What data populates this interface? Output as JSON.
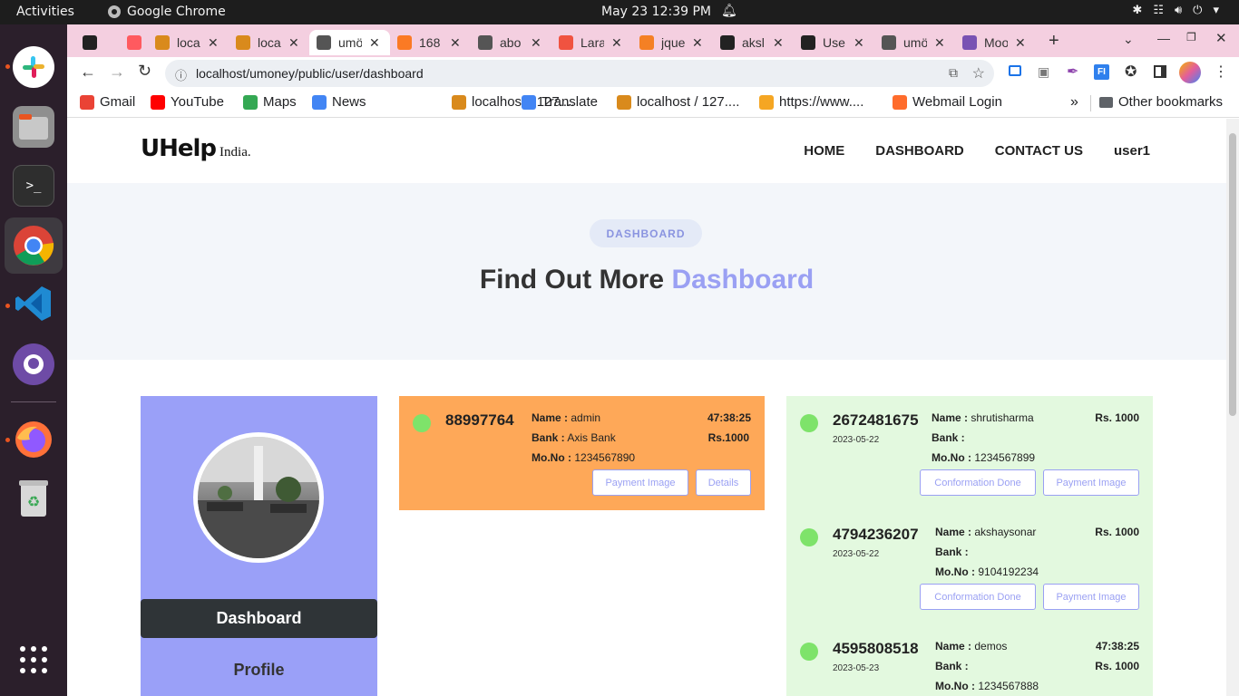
{
  "system": {
    "activities": "Activities",
    "app": "Google Chrome",
    "datetime": "May 23  12:39 PM"
  },
  "tabs": [
    {
      "title": "",
      "color": "#222"
    },
    {
      "title": "",
      "color": "#ff5a5f"
    },
    {
      "title": "loca",
      "color": "#d98a1c"
    },
    {
      "title": "loca",
      "color": "#d98a1c"
    },
    {
      "title": "umö",
      "color": "#555"
    },
    {
      "title": "168",
      "color": "#fb7a24"
    },
    {
      "title": "abo",
      "color": "#555"
    },
    {
      "title": "Lara",
      "color": "#f05340"
    },
    {
      "title": "jque",
      "color": "#f48024"
    },
    {
      "title": "aksl",
      "color": "#222"
    },
    {
      "title": "Use",
      "color": "#222"
    },
    {
      "title": "umö",
      "color": "#555"
    },
    {
      "title": "Moo",
      "color": "#7952b3"
    }
  ],
  "browser": {
    "url": "localhost/umoney/public/user/dashboard"
  },
  "bookmarks": [
    {
      "label": "Gmail",
      "color": "#ea4335"
    },
    {
      "label": "YouTube",
      "color": "#ff0000"
    },
    {
      "label": "Maps",
      "color": "#34a853"
    },
    {
      "label": "News",
      "color": "#4285f4"
    },
    {
      "label": "localhost / 127....",
      "color": "#d98a1c"
    },
    {
      "label": "Translate",
      "color": "#4285f4"
    },
    {
      "label": "localhost / 127....",
      "color": "#d98a1c"
    },
    {
      "label": "https://www....",
      "color": "#f5a623"
    },
    {
      "label": "Webmail Login",
      "color": "#ff6c2c"
    }
  ],
  "bookmarks_more": "»",
  "other_bookmarks": "Other bookmarks",
  "site": {
    "logo_main": "UHelp",
    "logo_sub": "India.",
    "nav": [
      "HOME",
      "DASHBOARD",
      "CONTACT US",
      "user1"
    ]
  },
  "hero": {
    "pill": "DASHBOARD",
    "heading": "Find Out More",
    "heading_accent": "Dashboard"
  },
  "sidebar": {
    "dashboard": "Dashboard",
    "profile": "Profile"
  },
  "labels": {
    "name": "Name :",
    "bank": "Bank :",
    "mono": "Mo.No :",
    "payment_image": "Payment Image",
    "details": "Details",
    "confirmation": "Conformation Done"
  },
  "orange_card": {
    "id": "88997764",
    "name": "admin",
    "bank": "Axis Bank",
    "mono": "1234567890",
    "timer": "47:38:25",
    "amount": "Rs.1000"
  },
  "green_cards": [
    {
      "id": "2672481675",
      "date": "2023-05-22",
      "name": "shrutisharma",
      "bank": "",
      "mono": "1234567899",
      "timer": "",
      "amount": "Rs. 1000"
    },
    {
      "id": "4794236207",
      "date": "2023-05-22",
      "name": "akshaysonar",
      "bank": "",
      "mono": "9104192234",
      "timer": "",
      "amount": "Rs. 1000"
    },
    {
      "id": "4595808518",
      "date": "2023-05-23",
      "name": "demos",
      "bank": "",
      "mono": "1234567888",
      "timer": "47:38:25",
      "amount": "Rs. 1000"
    }
  ]
}
